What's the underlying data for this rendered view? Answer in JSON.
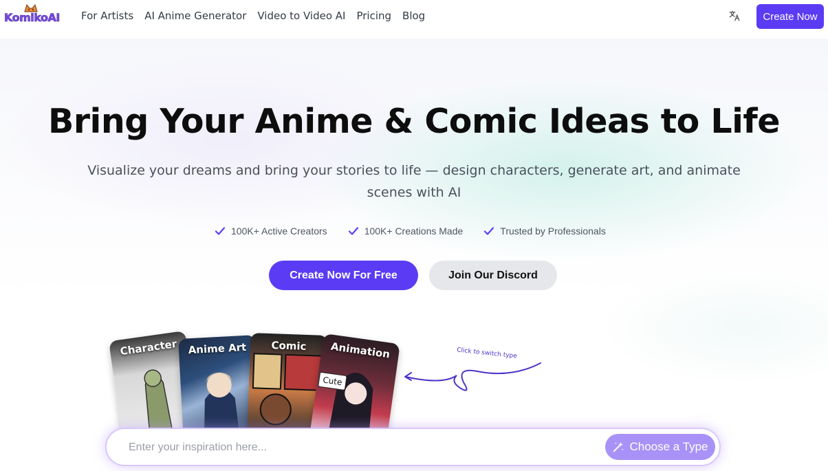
{
  "nav": {
    "logo_text": "KomikoAI",
    "links": [
      "For Artists",
      "AI Anime Generator",
      "Video to Video AI",
      "Pricing",
      "Blog"
    ],
    "translate_icon": "translate-icon",
    "cta_label": "Create Now"
  },
  "hero": {
    "title": "Bring Your Anime & Comic Ideas to Life",
    "subtitle": "Visualize your dreams and bring your stories to life — design characters, generate art, and animate scenes with AI",
    "features": [
      "100K+ Active Creators",
      "100K+ Creations Made",
      "Trusted by Professionals"
    ],
    "primary_button": "Create Now For Free",
    "secondary_button": "Join Our Discord"
  },
  "types": {
    "cards": [
      "Character",
      "Anime Art",
      "Comic",
      "Animation"
    ],
    "badge": "Cute",
    "hint": "Click to switch type"
  },
  "prompt": {
    "placeholder": "Enter your inspiration here...",
    "type_button": "Choose a Type"
  },
  "colors": {
    "accent": "#5b3cf4",
    "type_button": "#a892f7",
    "secondary_button": "#e6e7ea"
  }
}
